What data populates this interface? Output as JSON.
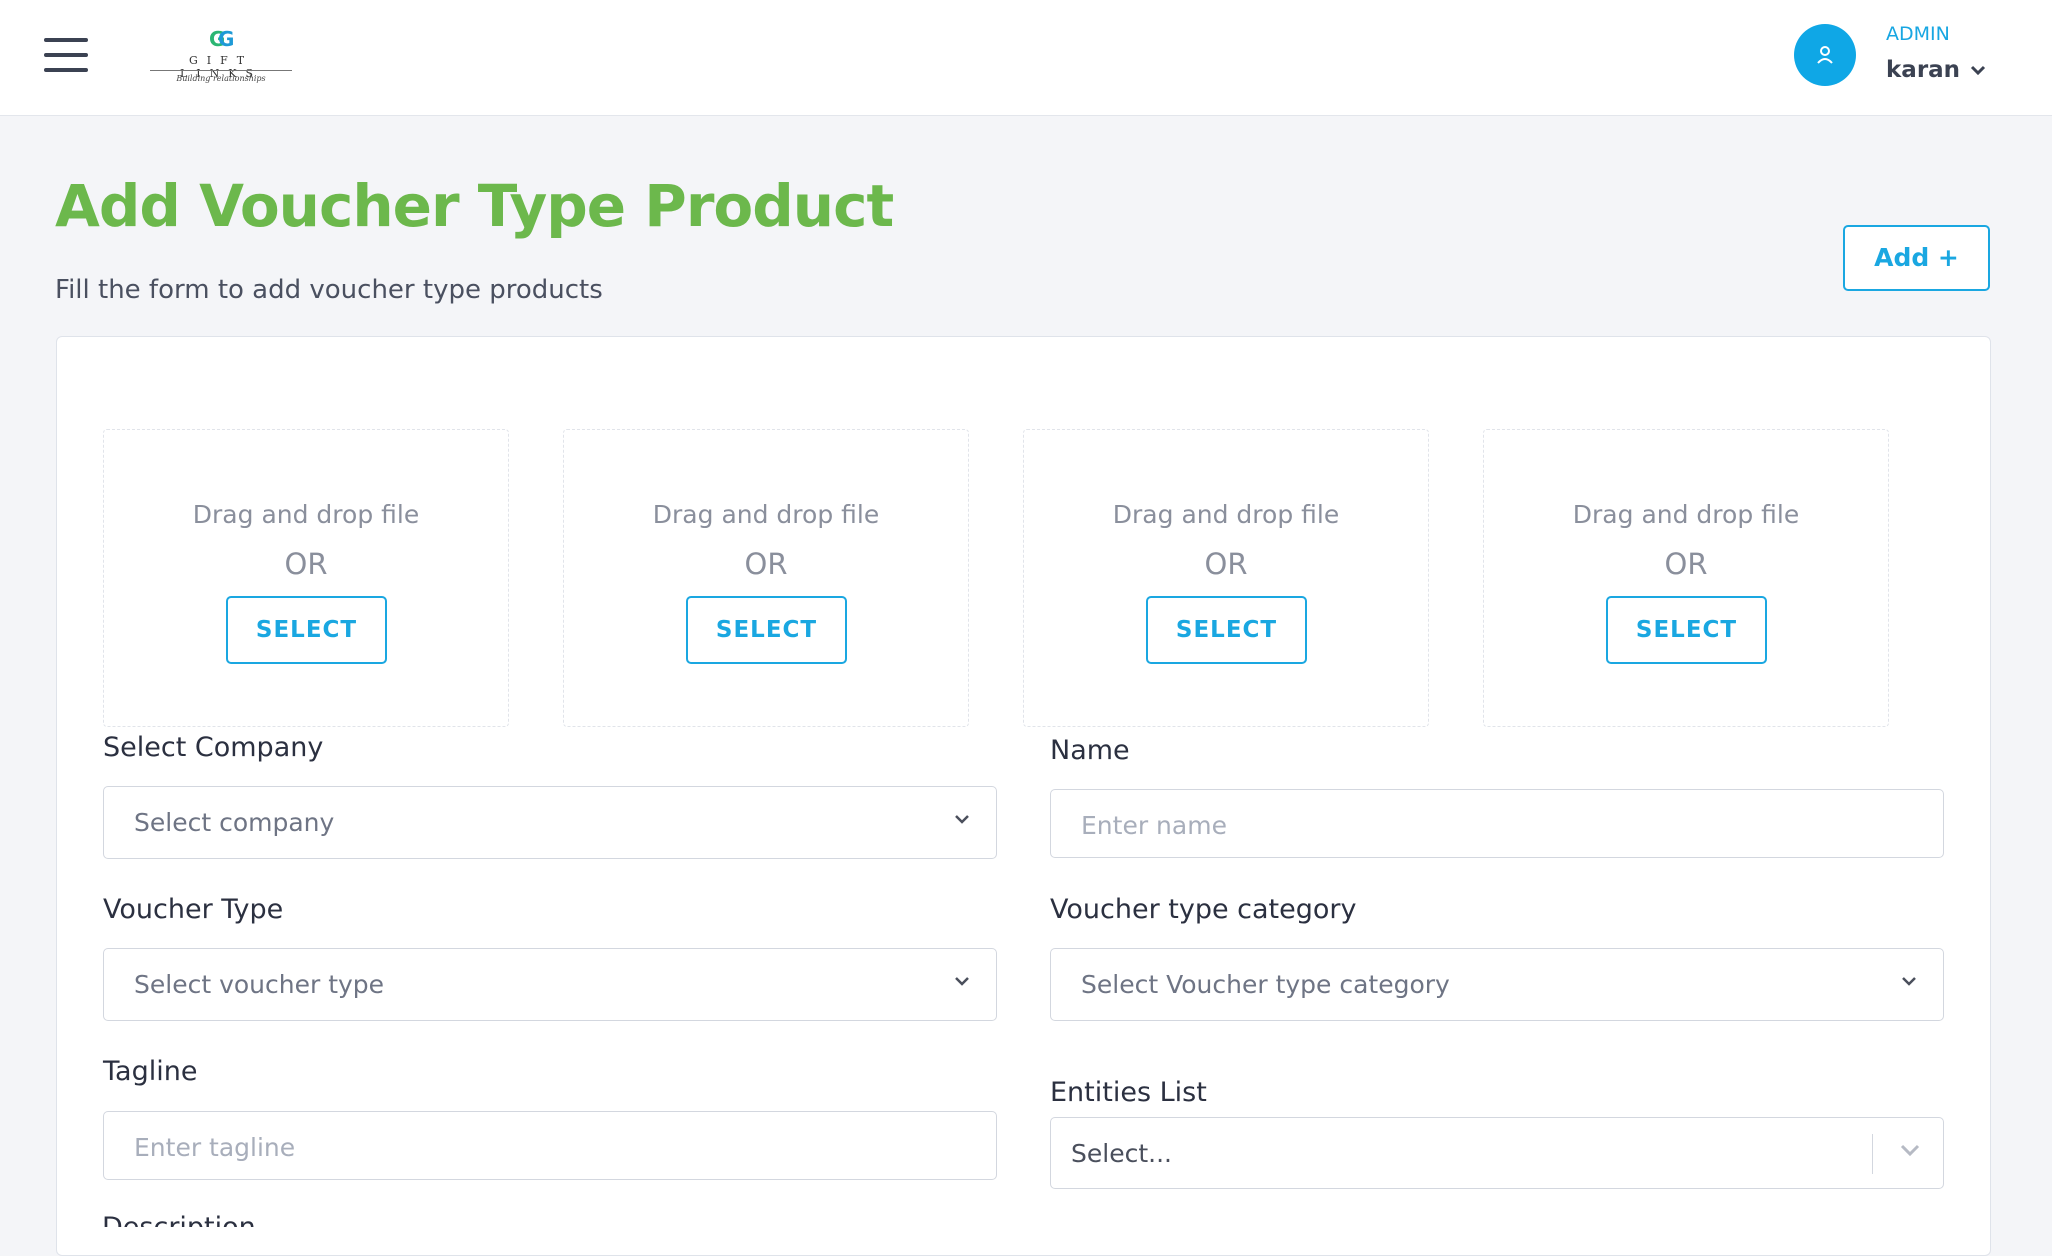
{
  "header": {
    "logo": {
      "text": "GIFT LINKS",
      "tagline": "Building relationships"
    },
    "user": {
      "role": "ADMIN",
      "name": "karan"
    },
    "icons": {
      "menu": "hamburger-menu-icon",
      "avatar": "user-icon",
      "dropdown": "chevron-down-icon"
    }
  },
  "page": {
    "title": "Add Voucher Type Product",
    "subtitle": "Fill the form to add voucher type products",
    "add_button": "Add +"
  },
  "upload_slots": [
    {
      "drag_text": "Drag and drop file",
      "or_text": "OR",
      "button": "SELECT"
    },
    {
      "drag_text": "Drag and drop file",
      "or_text": "OR",
      "button": "SELECT"
    },
    {
      "drag_text": "Drag and drop file",
      "or_text": "OR",
      "button": "SELECT"
    },
    {
      "drag_text": "Drag and drop file",
      "or_text": "OR",
      "button": "SELECT"
    }
  ],
  "form": {
    "company": {
      "label": "Select Company",
      "placeholder": "Select company"
    },
    "name": {
      "label": "Name",
      "placeholder": "Enter name"
    },
    "voucher_type": {
      "label": "Voucher Type",
      "placeholder": "Select voucher type"
    },
    "voucher_category": {
      "label": "Voucher type category",
      "placeholder": "Select Voucher type category"
    },
    "tagline": {
      "label": "Tagline",
      "placeholder": "Enter tagline"
    },
    "entities": {
      "label": "Entities List",
      "placeholder": "Select..."
    },
    "description": {
      "label": "Description"
    }
  },
  "colors": {
    "accent": "#1aa7e1",
    "title": "#6cb84c",
    "background": "#f4f5f8"
  }
}
